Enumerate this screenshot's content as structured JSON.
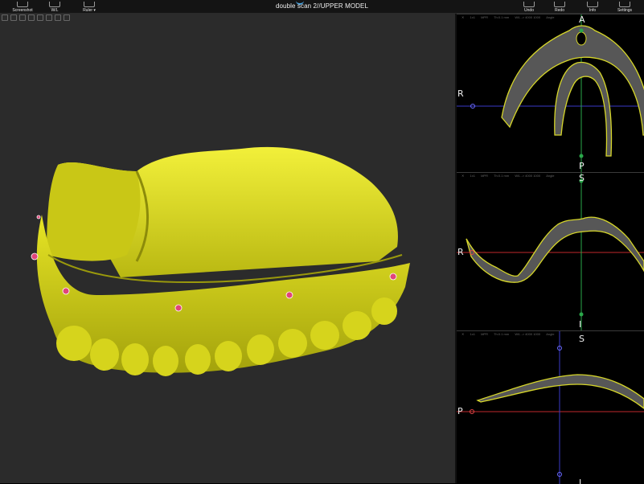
{
  "toolbar": {
    "title": "double scan 2//UPPER MODEL",
    "left_tools": [
      {
        "label": "Screenshot",
        "icon": "camera-icon"
      },
      {
        "label": "W/L",
        "icon": "eye-icon"
      },
      {
        "label": "Ruler",
        "icon": "ruler-icon"
      }
    ],
    "right_tools": [
      {
        "label": "Undo",
        "icon": "undo-icon"
      },
      {
        "label": "Redo",
        "icon": "redo-icon"
      },
      {
        "label": "Info",
        "icon": "info-icon"
      },
      {
        "label": "Settings",
        "icon": "gear-icon"
      }
    ]
  },
  "mpr_views": [
    {
      "name": "axial",
      "left_label": "R",
      "top_label": "A",
      "bottom_label": "P"
    },
    {
      "name": "coronal",
      "left_label": "R",
      "top_label": "S",
      "bottom_label": "I"
    },
    {
      "name": "sagittal",
      "left_label": "P",
      "top_label": "S",
      "bottom_label": "I"
    }
  ],
  "mpr_header": {
    "slice": "1x1",
    "mode": "MPR",
    "thickness": "Th:0.1 mm",
    "wl": "W/L -> 4000 1000",
    "angle": "Angle"
  },
  "colors": {
    "model": "#e3e21b",
    "outline": "#c8c81e",
    "landmark": "#e0457a",
    "axis_red": "#c0282c",
    "axis_blue": "#3a3ac8",
    "axis_green": "#2aa84a"
  }
}
